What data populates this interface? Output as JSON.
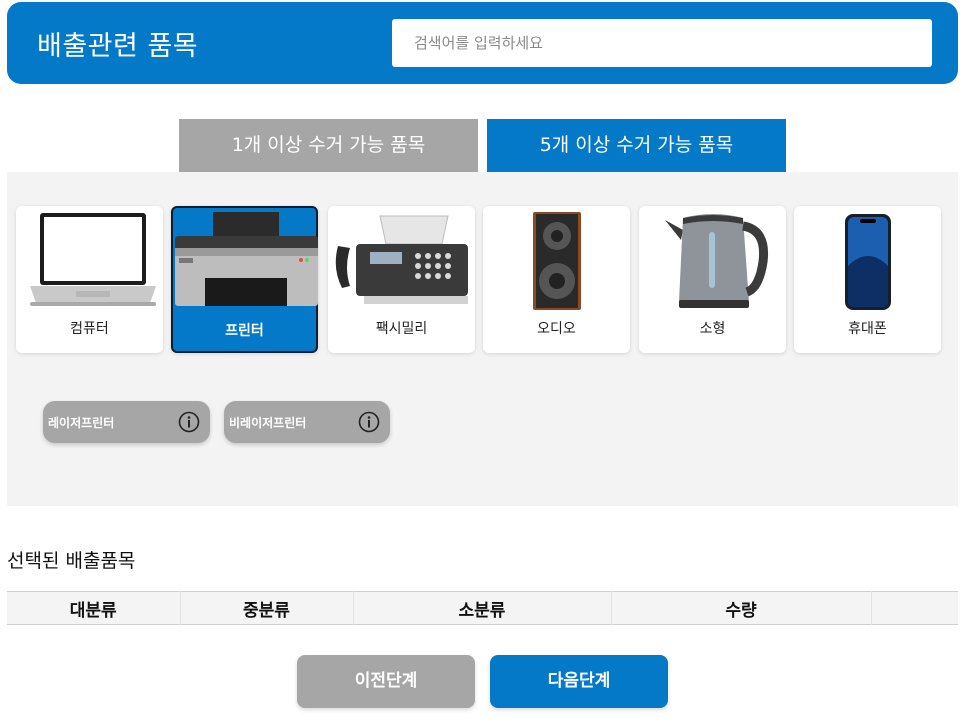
{
  "header": {
    "title": "배출관련 품목",
    "search_placeholder": "검색어를 입력하세요"
  },
  "tabs": [
    {
      "label": "1개 이상 수거 가능 품목",
      "active": false
    },
    {
      "label": "5개 이상 수거 가능 품목",
      "active": true
    }
  ],
  "items": [
    {
      "label": "컴퓨터",
      "icon": "laptop-icon",
      "selected": false
    },
    {
      "label": "프린터",
      "icon": "printer-icon",
      "selected": true
    },
    {
      "label": "팩시밀리",
      "icon": "fax-machine-icon",
      "selected": false
    },
    {
      "label": "오디오",
      "icon": "speaker-icon",
      "selected": false
    },
    {
      "label": "소형",
      "icon": "kettle-icon",
      "selected": false
    },
    {
      "label": "휴대폰",
      "icon": "smartphone-icon",
      "selected": false
    }
  ],
  "subitems": [
    {
      "label": "레이저프린터",
      "icon": "info-icon"
    },
    {
      "label": "비레이저프린터",
      "icon": "info-icon"
    }
  ],
  "selected_section": {
    "title": "선택된 배출품목",
    "columns": [
      "대분류",
      "중분류",
      "소분류",
      "수량",
      ""
    ]
  },
  "buttons": {
    "prev": "이전단계",
    "next": "다음단계"
  },
  "colors": {
    "accent": "#0479c8",
    "inactive": "#a6a6a6",
    "panel_bg": "#f3f3f3"
  }
}
